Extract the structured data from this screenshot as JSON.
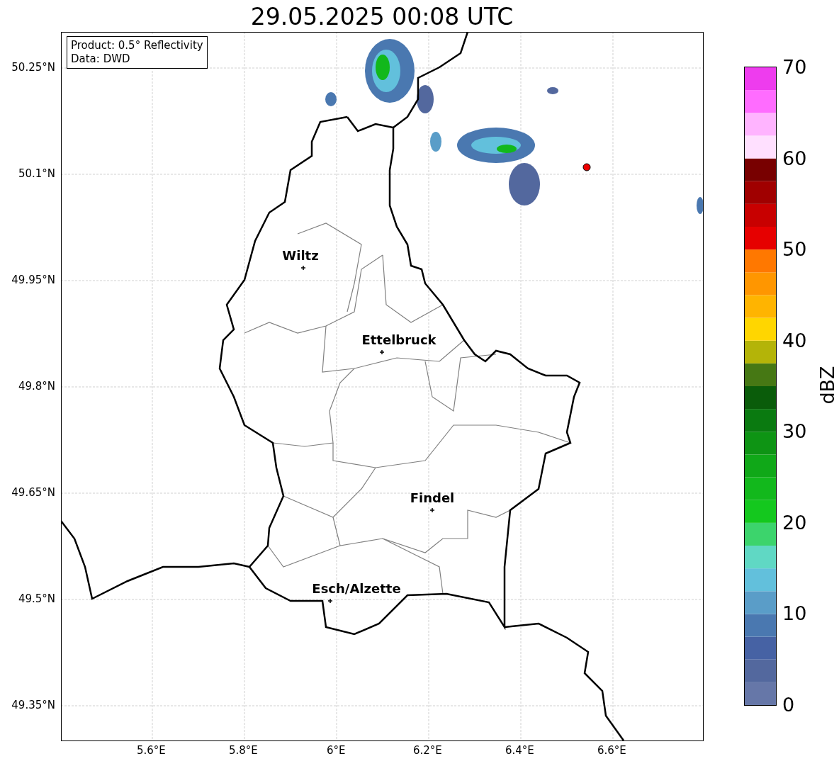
{
  "title": "29.05.2025 00:08 UTC",
  "info": [
    "Product: 0.5° Reflectivity",
    "Data: DWD"
  ],
  "lat_ticks": [
    "50.25°N",
    "50.1°N",
    "49.95°N",
    "49.8°N",
    "49.65°N",
    "49.5°N",
    "49.35°N"
  ],
  "lon_ticks": [
    "5.6°E",
    "5.8°E",
    "6°E",
    "6.2°E",
    "6.4°E",
    "6.6°E"
  ],
  "cities": [
    {
      "name": "Wiltz"
    },
    {
      "name": "Ettelbruck"
    },
    {
      "name": "Findel"
    },
    {
      "name": "Esch/Alzette"
    }
  ],
  "colorbar": {
    "label": "dBZ",
    "ticks": [
      "70",
      "60",
      "50",
      "40",
      "30",
      "20",
      "10",
      "0"
    ],
    "segments": [
      {
        "color": "#6677a8"
      },
      {
        "color": "#53689e"
      },
      {
        "color": "#4662a4"
      },
      {
        "color": "#4a78b0"
      },
      {
        "color": "#5a9dc8"
      },
      {
        "color": "#62c0dc"
      },
      {
        "color": "#60d8c4"
      },
      {
        "color": "#3cd46c"
      },
      {
        "color": "#14c81e"
      },
      {
        "color": "#12b81c"
      },
      {
        "color": "#10a818"
      },
      {
        "color": "#0e9414"
      },
      {
        "color": "#0a7a10"
      },
      {
        "color": "#0a5c0a"
      },
      {
        "color": "#467814"
      },
      {
        "color": "#b4b408"
      },
      {
        "color": "#ffd600"
      },
      {
        "color": "#ffb400"
      },
      {
        "color": "#ff9600"
      },
      {
        "color": "#ff7800"
      },
      {
        "color": "#e60000"
      },
      {
        "color": "#c80000"
      },
      {
        "color": "#a00000"
      },
      {
        "color": "#780000"
      },
      {
        "color": "#ffe0ff"
      },
      {
        "color": "#ffb4ff"
      },
      {
        "color": "#ff6cff"
      },
      {
        "color": "#ee3cee"
      }
    ]
  }
}
